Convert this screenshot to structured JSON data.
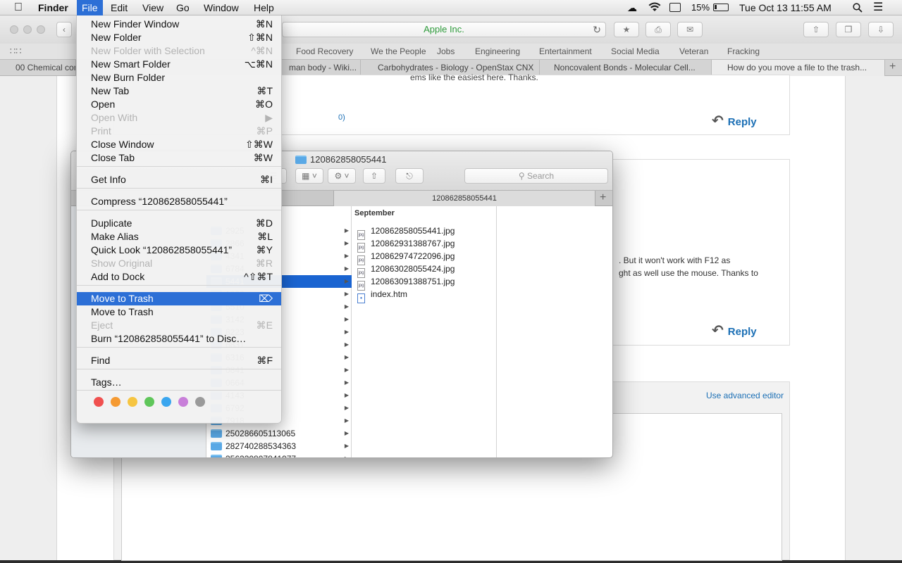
{
  "menubar": {
    "app": "Finder",
    "items": [
      "File",
      "Edit",
      "View",
      "Go",
      "Window",
      "Help"
    ],
    "battery": "15%",
    "datetime": "Tue Oct 13  11:55 AM"
  },
  "safari": {
    "address": "Apple Inc.",
    "favorites": [
      "Food Recovery",
      "We the People",
      "Jobs",
      "Engineering",
      "Entertainment",
      "Social Media",
      "Veteran",
      "Fracking"
    ],
    "tabs": [
      "00 Chemical com",
      "man body - Wiki...",
      "Carbohydrates - Biology - OpenStax CNX",
      "Noncovalent Bonds - Molecular Cell...",
      "How do you move a file to the trash..."
    ]
  },
  "webpage": {
    "snippet_top": "ems like the easiest here. Thanks.",
    "link_fragment": "0)",
    "reply_label": "Reply",
    "text_line1": ". But it won't work with F12 as",
    "text_line2": "ght as well use the mouse. Thanks to",
    "advanced_editor": "Use advanced editor"
  },
  "finder": {
    "title": "120862858055441",
    "search_placeholder": "Search",
    "tab_label": "120862858055441",
    "column1": [
      {
        "name": "2925"
      },
      {
        "name": "2866"
      },
      {
        "name": "4341"
      },
      {
        "name": "6784"
      },
      {
        "name": "5441",
        "selected": true
      },
      {
        "name": "1922"
      },
      {
        "name": "5510"
      },
      {
        "name": "3142"
      },
      {
        "name": "8223"
      },
      {
        "name": "6831"
      },
      {
        "name": "6316"
      },
      {
        "name": "0841"
      },
      {
        "name": "0664"
      },
      {
        "name": "4143"
      },
      {
        "name": "6792"
      },
      {
        "name": "7918"
      },
      {
        "name": "250286605113065"
      },
      {
        "name": "282740288534363"
      },
      {
        "name": "356330807841977"
      }
    ],
    "column2_header": "September",
    "column2": [
      {
        "name": "120862858055441.jpg",
        "kind": "jpg"
      },
      {
        "name": "120862931388767.jpg",
        "kind": "jpg"
      },
      {
        "name": "120862974722096.jpg",
        "kind": "jpg"
      },
      {
        "name": "120863028055424.jpg",
        "kind": "jpg"
      },
      {
        "name": "120863091388751.jpg",
        "kind": "jpg"
      },
      {
        "name": "index.htm",
        "kind": "htm"
      }
    ]
  },
  "file_menu": {
    "items": [
      {
        "label": "New Finder Window",
        "shortcut": "⌘N"
      },
      {
        "label": "New Folder",
        "shortcut": "⇧⌘N"
      },
      {
        "label": "New Folder with Selection",
        "shortcut": "^⌘N",
        "disabled": true
      },
      {
        "label": "New Smart Folder",
        "shortcut": "⌥⌘N"
      },
      {
        "label": "New Burn Folder",
        "shortcut": ""
      },
      {
        "label": "New Tab",
        "shortcut": "⌘T"
      },
      {
        "label": "Open",
        "shortcut": "⌘O"
      },
      {
        "label": "Open With",
        "shortcut": "▶",
        "disabled": true
      },
      {
        "label": "Print",
        "shortcut": "⌘P",
        "disabled": true
      },
      {
        "label": "Close Window",
        "shortcut": "⇧⌘W"
      },
      {
        "label": "Close Tab",
        "shortcut": "⌘W"
      },
      {
        "label": "Get Info",
        "shortcut": "⌘I"
      },
      {
        "label": "Compress “120862858055441”",
        "shortcut": ""
      },
      {
        "label": "Duplicate",
        "shortcut": "⌘D"
      },
      {
        "label": "Make Alias",
        "shortcut": "⌘L"
      },
      {
        "label": "Quick Look “120862858055441”",
        "shortcut": "⌘Y"
      },
      {
        "label": "Show Original",
        "shortcut": "⌘R",
        "disabled": true
      },
      {
        "label": "Add to Dock",
        "shortcut": "^⇧⌘T"
      },
      {
        "label": "Move to Trash",
        "shortcut": "⌦",
        "highlighted": true
      },
      {
        "label": "Move to Trash",
        "shortcut": ""
      },
      {
        "label": "Eject",
        "shortcut": "⌘E",
        "disabled": true
      },
      {
        "label": "Burn “120862858055441” to Disc…",
        "shortcut": ""
      },
      {
        "label": "Find",
        "shortcut": "⌘F"
      },
      {
        "label": "Tags…",
        "shortcut": ""
      }
    ],
    "tag_colors": [
      "#f0504f",
      "#f59a32",
      "#f6c541",
      "#5fc65a",
      "#3aa6ef",
      "#c87fd9",
      "#9a9a9a"
    ]
  }
}
